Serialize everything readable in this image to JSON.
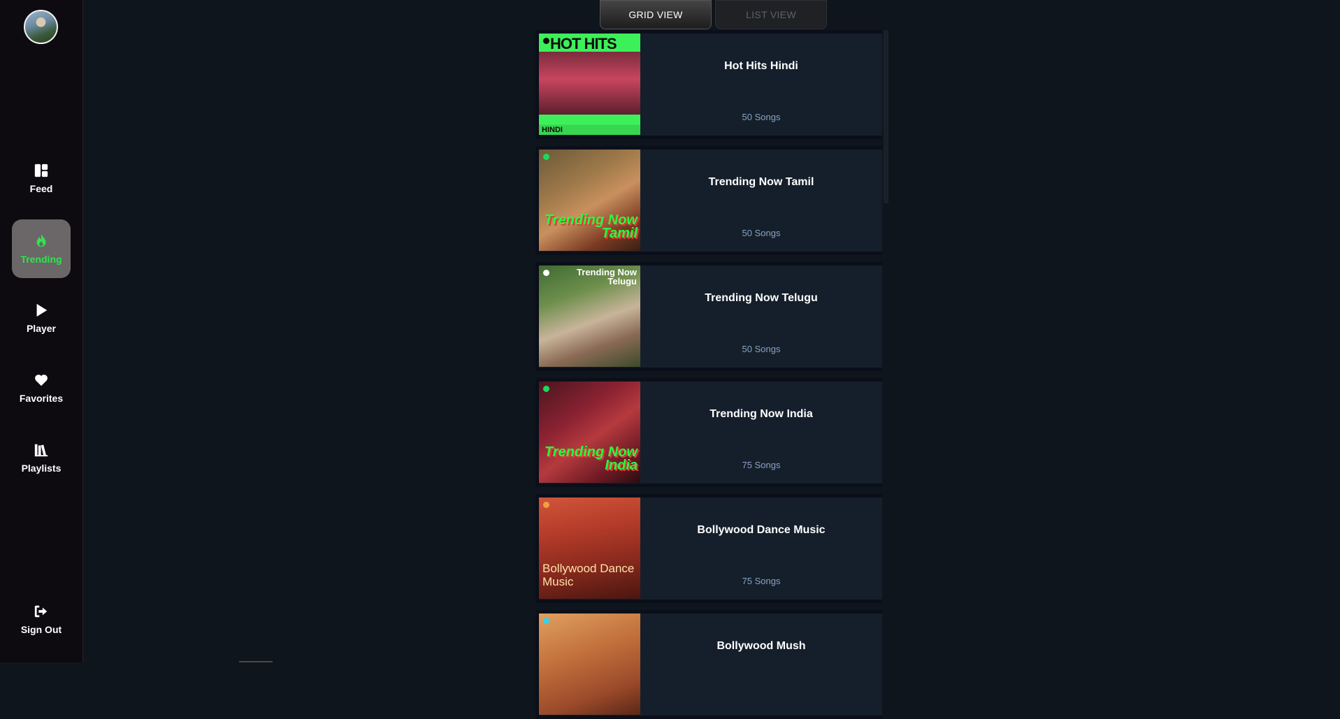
{
  "sidebar": {
    "items": [
      {
        "label": "Feed",
        "icon": "dashboard-icon"
      },
      {
        "label": "Trending",
        "icon": "flame-icon",
        "active": true
      },
      {
        "label": "Player",
        "icon": "play-icon"
      },
      {
        "label": "Favorites",
        "icon": "heart-icon"
      },
      {
        "label": "Playlists",
        "icon": "library-icon"
      }
    ],
    "signout": {
      "label": "Sign Out",
      "icon": "sign-out-icon"
    }
  },
  "view_toggle": {
    "grid_label": "GRID VIEW",
    "list_label": "LIST VIEW",
    "selected": "grid"
  },
  "playlists": [
    {
      "title": "Hot Hits Hindi",
      "songs": "50 Songs",
      "cover_text": "HOT HITS",
      "cover_sub": "HINDI"
    },
    {
      "title": "Trending Now Tamil",
      "songs": "50 Songs",
      "cover_text": "Trending Now Tamil"
    },
    {
      "title": "Trending Now Telugu",
      "songs": "50 Songs",
      "cover_text": "Trending Now Telugu"
    },
    {
      "title": "Trending Now India",
      "songs": "75 Songs",
      "cover_text": "Trending Now India"
    },
    {
      "title": "Bollywood Dance Music",
      "songs": "75 Songs",
      "cover_text": "Bollywood Dance Music"
    },
    {
      "title": "Bollywood Mush",
      "songs": ""
    }
  ],
  "colors": {
    "accent": "#2ee54d",
    "subtext": "#8aa3c4",
    "card_bg": "#151f2b",
    "page_bg": "#0f151d"
  }
}
